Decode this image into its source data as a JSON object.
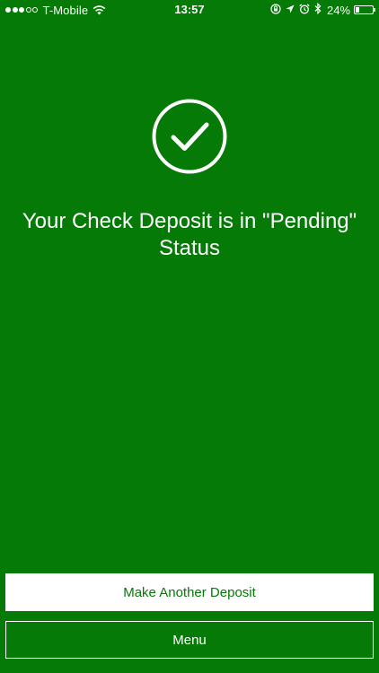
{
  "status_bar": {
    "carrier": "T-Mobile",
    "time": "13:57",
    "battery_percent": "24%",
    "battery_level": 0.24,
    "signal_strength": 3,
    "signal_max": 5,
    "icons": [
      "wifi-icon",
      "orientation-lock-icon",
      "location-icon",
      "alarm-icon",
      "bluetooth-icon",
      "battery-icon"
    ]
  },
  "main": {
    "status_icon": "checkmark-circle-icon",
    "title": "Your Check Deposit is in \"Pending\" Status"
  },
  "actions": {
    "primary_label": "Make Another Deposit",
    "secondary_label": "Menu"
  },
  "colors": {
    "background": "#067A06",
    "foreground": "#FFFFFF"
  }
}
